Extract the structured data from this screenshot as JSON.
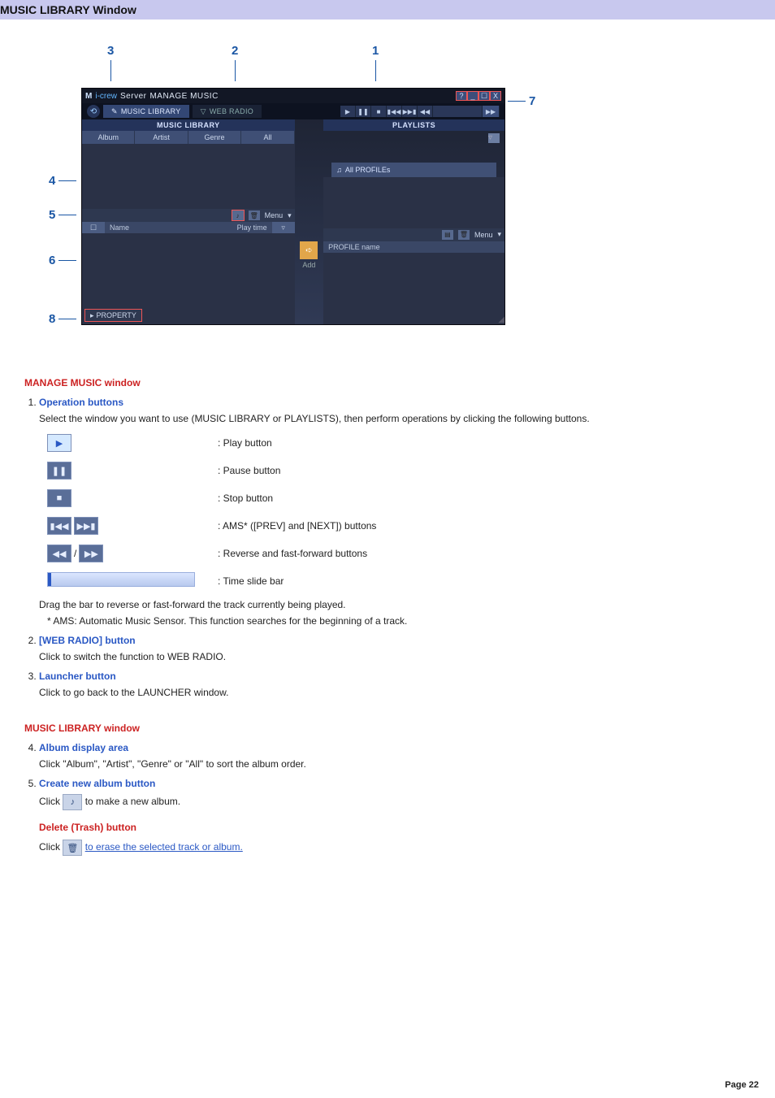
{
  "header": {
    "title": "MUSIC LIBRARY Window"
  },
  "callouts": {
    "c1": "1",
    "c2": "2",
    "c3": "3",
    "c4": "4",
    "c5": "5",
    "c6": "6",
    "c7": "7",
    "c8": "8"
  },
  "app": {
    "title_logo": "M",
    "title_brand": "i-crew",
    "title_server": "Server",
    "title_section": "MANAGE MUSIC",
    "win_help": "?",
    "win_min": "_",
    "win_max": "☐",
    "win_close": "X",
    "back_glyph": "⟲",
    "tab_library": "MUSIC LIBRARY",
    "tab_webradio": "WEB RADIO",
    "tab_filter_glyph": "▽",
    "tab_lib_glyph": "✎",
    "transport": {
      "play": "▶",
      "pause": "❚❚",
      "stop": "■",
      "prev": "▮◀◀",
      "next": "▶▶▮",
      "rew": "◀◀",
      "ff": "▶▶"
    },
    "left": {
      "head": "MUSIC LIBRARY",
      "sort": {
        "album": "Album",
        "artist": "Artist",
        "genre": "Genre",
        "all": "All"
      },
      "tool_create_glyph": "♪",
      "tool_trash_glyph": "🗑",
      "tool_menu": "Menu",
      "tool_menu_glyph": "▾",
      "list": {
        "col_check": "☐",
        "col_name": "Name",
        "col_playtime": "Play time",
        "drop": "▿"
      }
    },
    "right": {
      "head": "PLAYLISTS",
      "drop_glyph": "▿",
      "profiles_glyph": "♫",
      "profiles": "All PROFILEs",
      "tool_create_glyph": "▤",
      "tool_trash_glyph": "🗑",
      "tool_menu": "Menu",
      "tool_menu_glyph": "▾",
      "list": {
        "col_name": "PROFILE name"
      }
    },
    "between": {
      "arrow_glyph": "➪",
      "add": "Add"
    },
    "property": "PROPERTY",
    "property_glyph": "▸"
  },
  "doc": {
    "h_manage": "MANAGE MUSIC window",
    "s1_title": "Operation buttons",
    "s1_intro": "Select the window you want to use (MUSIC LIBRARY or PLAYLISTS), then perform operations by clicking the following buttons.",
    "btn_play": ": Play button",
    "btn_pause": ": Pause button",
    "btn_stop": ": Stop button",
    "btn_ams": ": AMS* ([PREV] and [NEXT]) buttons",
    "btn_revff": ": Reverse and fast-forward buttons",
    "btn_time": ": Time slide bar",
    "drag_note": "Drag the bar to reverse or fast-forward the track currently being played.",
    "ams_note": "* AMS: Automatic Music Sensor. This function searches for the beginning of a track.",
    "s2_title": "[WEB RADIO] button",
    "s2_body": "Click to switch the function to WEB RADIO.",
    "s3_title": "Launcher button",
    "s3_body": "Click to go back to the LAUNCHER window.",
    "h_library": "MUSIC LIBRARY window",
    "s4_title": "Album display area",
    "s4_body": "Click \"Album\", \"Artist\", \"Genre\" or \"All\" to sort the album order.",
    "s5_title": "Create new album button",
    "s5_pre": "Click ",
    "s5_post": " to make a new album.",
    "h_delete": "Delete (Trash) button",
    "s_del_pre": "Click ",
    "s_del_link": "to erase the selected track or album.",
    "icons": {
      "play": "▶",
      "pause": "❚❚",
      "stop": "■",
      "prev": "▮◀◀",
      "next": "▶▶▮",
      "rew": "◀◀",
      "ff": "▶▶",
      "sep": "/",
      "new_album": "♪",
      "trash": "🗑"
    }
  },
  "page": "Page 22"
}
